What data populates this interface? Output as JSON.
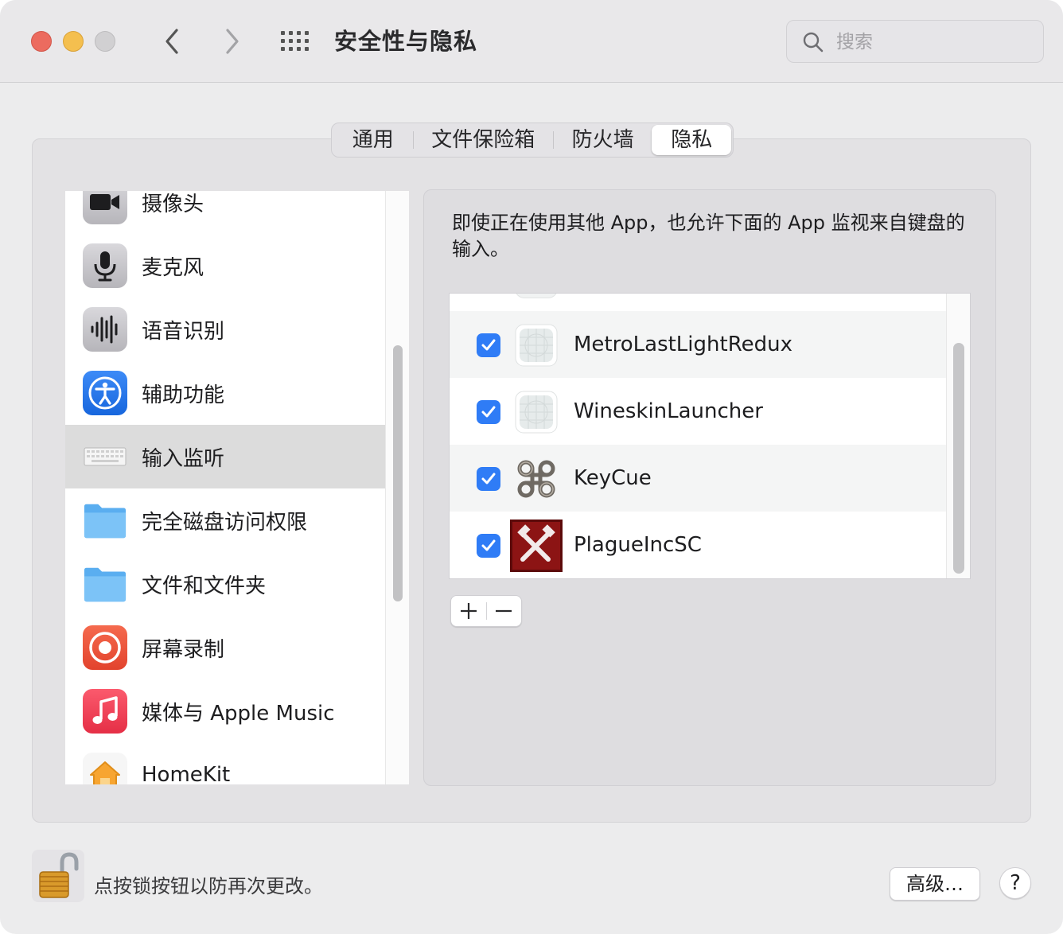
{
  "window": {
    "title": "安全性与隐私",
    "search_placeholder": "搜索"
  },
  "tabs": [
    {
      "label": "通用"
    },
    {
      "label": "文件保险箱"
    },
    {
      "label": "防火墙"
    },
    {
      "label": "隐私",
      "selected": true
    }
  ],
  "sidebar": {
    "items": [
      {
        "label": "摄像头",
        "icon": "camera-icon"
      },
      {
        "label": "麦克风",
        "icon": "microphone-icon"
      },
      {
        "label": "语音识别",
        "icon": "waveform-icon"
      },
      {
        "label": "辅助功能",
        "icon": "accessibility-icon"
      },
      {
        "label": "输入监听",
        "icon": "keyboard-icon",
        "selected": true
      },
      {
        "label": "完全磁盘访问权限",
        "icon": "folder-icon"
      },
      {
        "label": "文件和文件夹",
        "icon": "folder-icon"
      },
      {
        "label": "屏幕录制",
        "icon": "screen-record-icon"
      },
      {
        "label": "媒体与 Apple Music",
        "icon": "music-icon"
      },
      {
        "label": "HomeKit",
        "icon": "home-icon"
      }
    ]
  },
  "detail": {
    "description": "即使正在使用其他 App，也允许下面的 App 监视来自键盘的输入。",
    "apps": [
      {
        "name": "MetroLastLightRedux",
        "checked": true,
        "icon": "generic-app-icon"
      },
      {
        "name": "WineskinLauncher",
        "checked": true,
        "icon": "generic-app-icon"
      },
      {
        "name": "KeyCue",
        "checked": true,
        "icon": "keycue-command-icon"
      },
      {
        "name": "PlagueIncSC",
        "checked": true,
        "icon": "plague-inc-icon"
      }
    ],
    "add_symbol": "+",
    "remove_symbol": "−"
  },
  "footer": {
    "lock_text": "点按锁按钮以防再次更改。",
    "advanced_label": "高级…",
    "help_label": "?"
  },
  "colors": {
    "accent": "#2f7cf6",
    "selection": "#dcdcdc",
    "close": "#ec6b5f",
    "minimize": "#f4bf4f"
  }
}
